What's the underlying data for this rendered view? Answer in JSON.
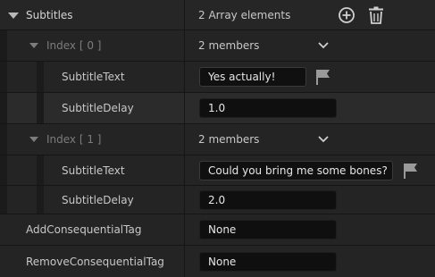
{
  "subtitles": {
    "label": "Subtitles",
    "summary": "2 Array elements",
    "add_icon": "plus-circle-icon",
    "delete_icon": "trash-icon",
    "elements": [
      {
        "index_label": "Index [ 0 ]",
        "summary": "2 members",
        "subtitle_text_label": "SubtitleText",
        "subtitle_text_value": "Yes actually!",
        "subtitle_delay_label": "SubtitleDelay",
        "subtitle_delay_value": "1.0"
      },
      {
        "index_label": "Index [ 1 ]",
        "summary": "2 members",
        "subtitle_text_label": "SubtitleText",
        "subtitle_text_value": "Could you bring me some bones?",
        "subtitle_delay_label": "SubtitleDelay",
        "subtitle_delay_value": "2.0"
      }
    ]
  },
  "add_consequential_tag": {
    "label": "AddConsequentialTag",
    "value": "None"
  },
  "remove_consequential_tag": {
    "label": "RemoveConsequentialTag",
    "value": "None"
  },
  "colors": {
    "panel_background": "#151515",
    "row_background": "#242424",
    "row_alt_background": "#2b2b2b",
    "field_background": "#0f0f0f",
    "text": "#c8c8c8",
    "muted_text": "#7c7c7c"
  }
}
